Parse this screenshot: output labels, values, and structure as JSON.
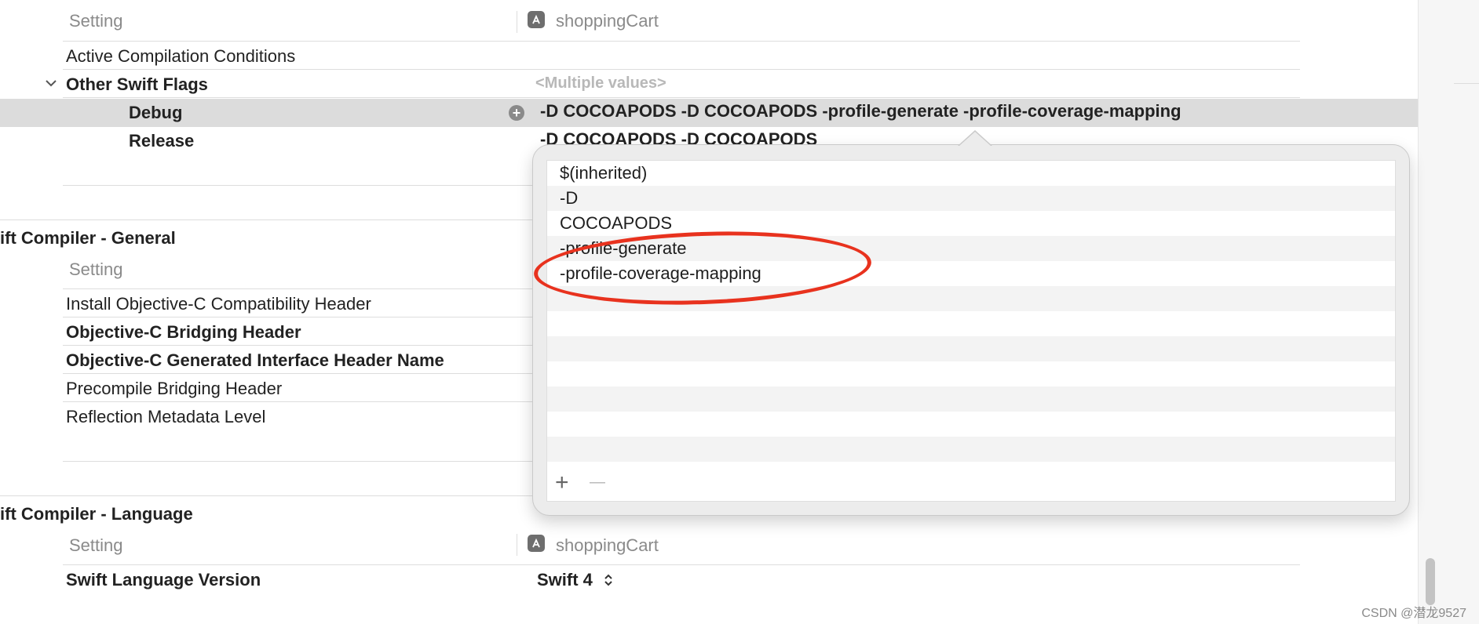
{
  "colors": {
    "annotation": "#e8321e",
    "selected_row": "#dcdcdc",
    "popover_bg": "#ececec",
    "stripe": "#f3f3f3"
  },
  "top_section": {
    "header": {
      "setting_label": "Setting",
      "target_icon": "app-store-icon",
      "target_name": "shoppingCart"
    },
    "rows": {
      "active_conditions": "Active Compilation Conditions",
      "other_swift_flags": {
        "label": "Other Swift Flags",
        "value": "<Multiple values>",
        "disclosure_icon": "chevron-down-icon"
      },
      "debug": {
        "label": "Debug",
        "value": "-D COCOAPODS -D COCOAPODS -profile-generate -profile-coverage-mapping",
        "add_icon": "plus-circle-icon"
      },
      "release": {
        "label": "Release",
        "value": "-D COCOAPODS -D COCOAPODS"
      }
    }
  },
  "general_section": {
    "title": "ift Compiler - General",
    "header": {
      "setting_label": "Setting"
    },
    "rows": [
      {
        "label": "Install Objective-C Compatibility Header",
        "bold": false
      },
      {
        "label": "Objective-C Bridging Header",
        "bold": true
      },
      {
        "label": "Objective-C Generated Interface Header Name",
        "bold": true
      },
      {
        "label": "Precompile Bridging Header",
        "bold": false
      },
      {
        "label": "Reflection Metadata Level",
        "bold": false
      }
    ]
  },
  "language_section": {
    "title": "ift Compiler - Language",
    "header": {
      "setting_label": "Setting",
      "target_icon": "app-store-icon",
      "target_name": "shoppingCart"
    },
    "swift_language_version": {
      "label": "Swift Language Version",
      "value": "Swift 4",
      "stepper_icon": "up-down-chevron-icon"
    }
  },
  "popover": {
    "items": [
      "$(inherited)",
      "-D",
      "COCOAPODS",
      "-profile-generate",
      "-profile-coverage-mapping"
    ],
    "add_button": "+",
    "remove_button": "—"
  },
  "watermark": "CSDN @潜龙9527"
}
